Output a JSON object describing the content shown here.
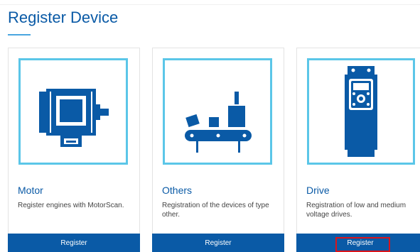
{
  "page": {
    "title": "Register Device"
  },
  "cards": [
    {
      "title": "Motor",
      "description": "Register engines with MotorScan.",
      "button": "Register",
      "icon": "motor-icon"
    },
    {
      "title": "Others",
      "description": "Registration of the devices of type other.",
      "button": "Register",
      "icon": "conveyor-icon"
    },
    {
      "title": "Drive",
      "description": "Registration of low and medium voltage drives.",
      "button": "Register",
      "icon": "drive-icon"
    }
  ],
  "colors": {
    "brand": "#0a5aa6",
    "accent": "#5bc6e8",
    "highlight": "#d9141b"
  }
}
